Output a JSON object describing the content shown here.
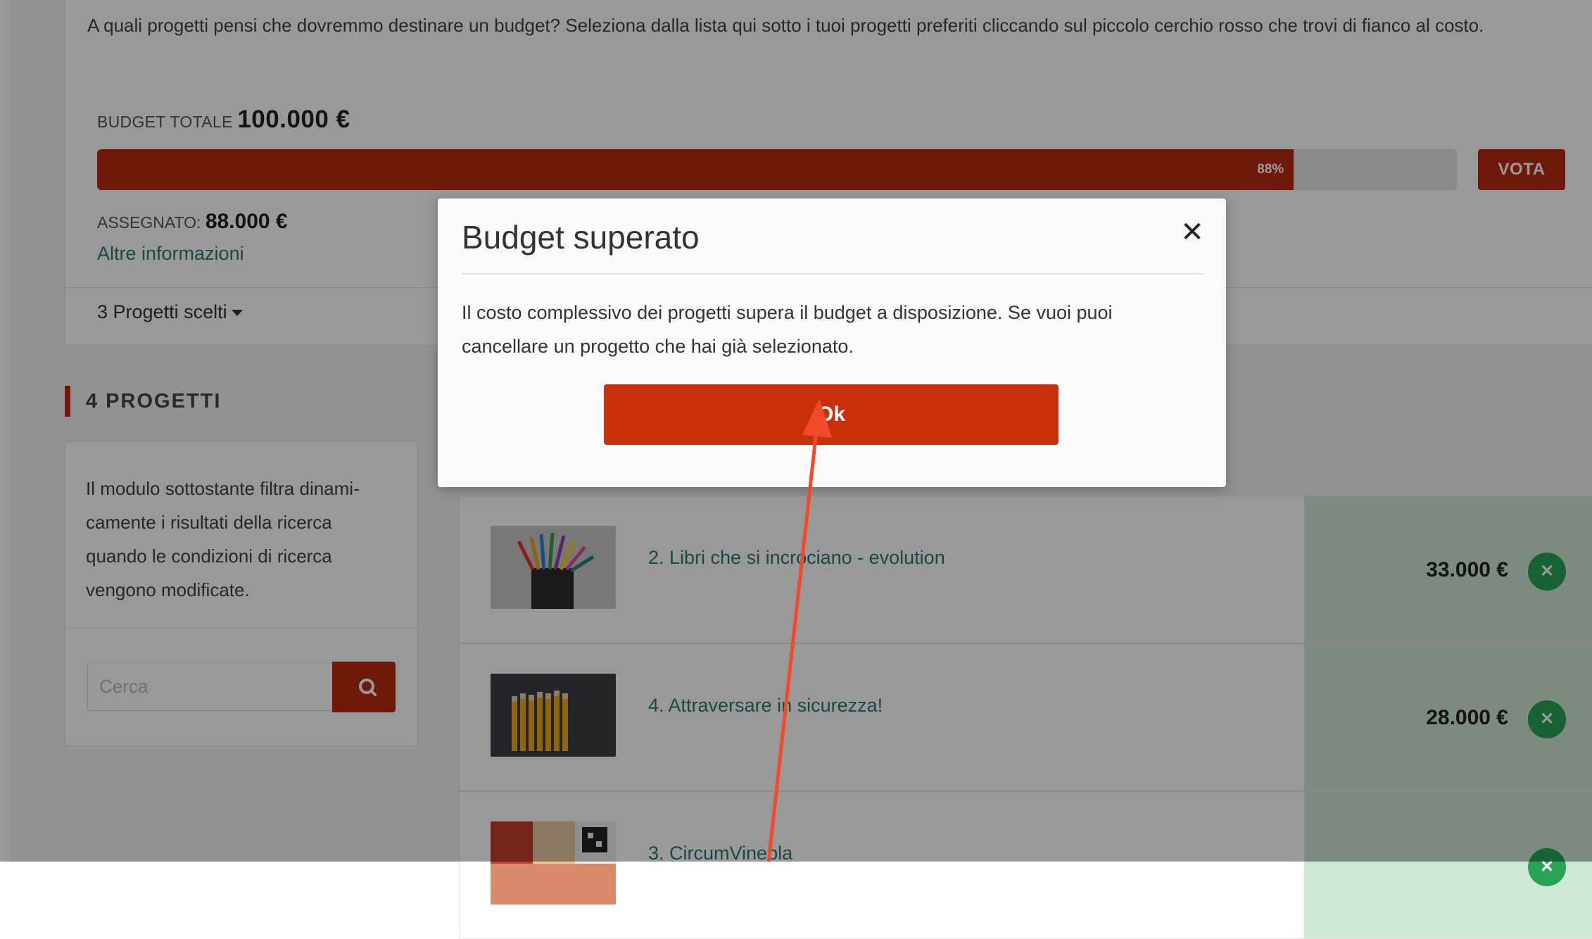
{
  "budget": {
    "intro": "A quali progetti pensi che dovremmo destinare un budget? Seleziona dalla lista qui sotto i tuoi progetti preferiti cliccando sul piccolo cerchio rosso che trovi di fianco al costo.",
    "total_label": "BUDGET TOTALE",
    "total_value": "100.000 €",
    "progress_percent": 88,
    "progress_text": "88%",
    "vote_label": "VOTA",
    "assigned_label": "ASSEGNATO:",
    "assigned_value": "88.000 €",
    "more_info": "Altre informazioni",
    "chosen_projects": "3 Progetti scelti"
  },
  "section": {
    "title": "4 PROGETTI"
  },
  "filter": {
    "description": "Il modulo sottostante filtra dinami-camente i risultati della ricerca quando le condizioni di ricerca vengono modificate.",
    "search_placeholder": "Cerca",
    "search_icon": "search-icon"
  },
  "projects": [
    {
      "title": "2. Libri che si incrociano - evolution",
      "cost": "33.000 €",
      "image": "colored-pencils"
    },
    {
      "title": "4. Attraversare in sicurezza!",
      "cost": "28.000 €",
      "image": "yellow-pencils"
    },
    {
      "title": "3. CircumVinebla",
      "cost": "",
      "image": "collage"
    }
  ],
  "modal": {
    "title": "Budget superato",
    "close_icon": "close-icon",
    "body": "Il costo complessivo dei progetti supera il budget a disposizione. Se vuoi puoi cancellare un progetto che hai già selezionato.",
    "ok_label": "Ok"
  },
  "colors": {
    "accent": "#b82a0f",
    "ok_button": "#c8300c",
    "link": "#2a7a77",
    "selected_cell": "#cfe8d6",
    "remove_button": "#27a354",
    "annotation_arrow": "#f04a2a"
  }
}
